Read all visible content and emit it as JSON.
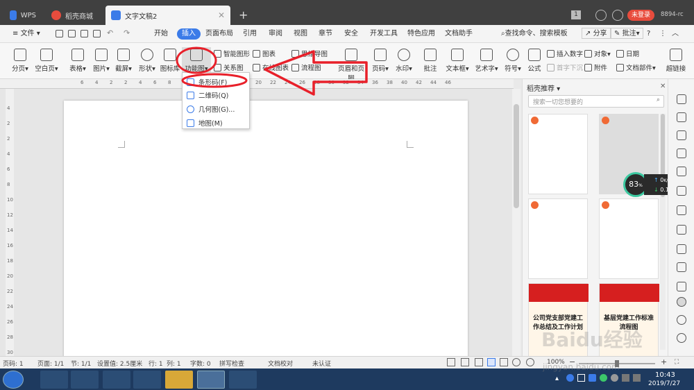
{
  "tabs": [
    {
      "label": "WPS"
    },
    {
      "label": "稻壳商城"
    },
    {
      "label": "文字文稿2"
    }
  ],
  "titlebar": {
    "page_count": "1",
    "login_label": "未登录",
    "user_code": "8894-rc"
  },
  "menu": {
    "file": "文件",
    "items": [
      "开始",
      "插入",
      "页面布局",
      "引用",
      "审阅",
      "视图",
      "章节",
      "安全",
      "开发工具",
      "特色应用",
      "文档助手"
    ],
    "active": "插入",
    "search": "查找命令、搜索模板",
    "share": "分享",
    "comment": "批注"
  },
  "ribbon": {
    "big": [
      {
        "label": "分页▾"
      },
      {
        "label": "空白页▾"
      },
      {
        "label": "表格▾"
      },
      {
        "label": "图片▾"
      },
      {
        "label": "截屏▾"
      },
      {
        "label": "形状▾"
      },
      {
        "label": "图标库"
      },
      {
        "label": "功能图▾"
      },
      {
        "label": "页眉和页脚"
      },
      {
        "label": "页码▾"
      },
      {
        "label": "水印▾"
      },
      {
        "label": "批注"
      },
      {
        "label": "文本框▾"
      },
      {
        "label": "艺术字▾"
      },
      {
        "label": "符号▾"
      },
      {
        "label": "公式"
      },
      {
        "label": "超链接"
      }
    ],
    "small": [
      {
        "label": "智能图形"
      },
      {
        "label": "图表"
      },
      {
        "label": "思维导图"
      },
      {
        "label": "关系图"
      },
      {
        "label": "在线图表"
      },
      {
        "label": "流程图"
      },
      {
        "label": "插入数字"
      },
      {
        "label": "对象▾"
      },
      {
        "label": "日期"
      },
      {
        "label": "首字下沉"
      },
      {
        "label": "附件"
      },
      {
        "label": "文档部件▾"
      }
    ]
  },
  "ruler": {
    "ticks": [
      "6",
      "4",
      "2",
      "2",
      "4",
      "6",
      "8",
      "10",
      "12",
      "14",
      "16",
      "18",
      "20",
      "22",
      "24",
      "26",
      "28",
      "30",
      "32",
      "34",
      "36",
      "38",
      "40",
      "42",
      "44",
      "46"
    ]
  },
  "vruler": {
    "ticks": [
      "4",
      "2",
      "2",
      "4",
      "6",
      "8",
      "10",
      "12",
      "14",
      "16",
      "18",
      "20",
      "22",
      "24",
      "26",
      "28",
      "30"
    ]
  },
  "dropdown": {
    "items": [
      {
        "label": "条形码(F)"
      },
      {
        "label": "二维码(Q)"
      },
      {
        "label": "几何图(G)..."
      },
      {
        "label": "地图(M)"
      }
    ]
  },
  "panel": {
    "title": "稻壳推荐",
    "search_placeholder": "搜索一切您想要的",
    "cards": [
      {
        "title": ""
      },
      {
        "title": ""
      },
      {
        "title": ""
      },
      {
        "title": ""
      },
      {
        "title": "公司党支部党建工作总结及工作计划"
      },
      {
        "title": "基层党建工作标准流程图"
      }
    ]
  },
  "net": {
    "percent": "83",
    "unit": "%",
    "up": "0",
    "down": "0.1",
    "rate_unit": "K/s"
  },
  "status": {
    "items": [
      "页码: 1",
      "页面: 1/1",
      "节: 1/1",
      "设置值: 2.5厘米",
      "行: 1",
      "列: 1",
      "字数: 0",
      "拼写检查",
      "文档校对",
      "未认证"
    ],
    "zoom": "100%"
  },
  "taskbar": {
    "time": "10:43",
    "date": "2019/7/27"
  },
  "watermark": {
    "text": "Baidu经验",
    "url": "jingyan.baidu.com"
  },
  "colors": {
    "accent": "#3b7be8",
    "annotation": "#e8202a",
    "login": "#e84c3d",
    "tabbar": "#404040"
  }
}
